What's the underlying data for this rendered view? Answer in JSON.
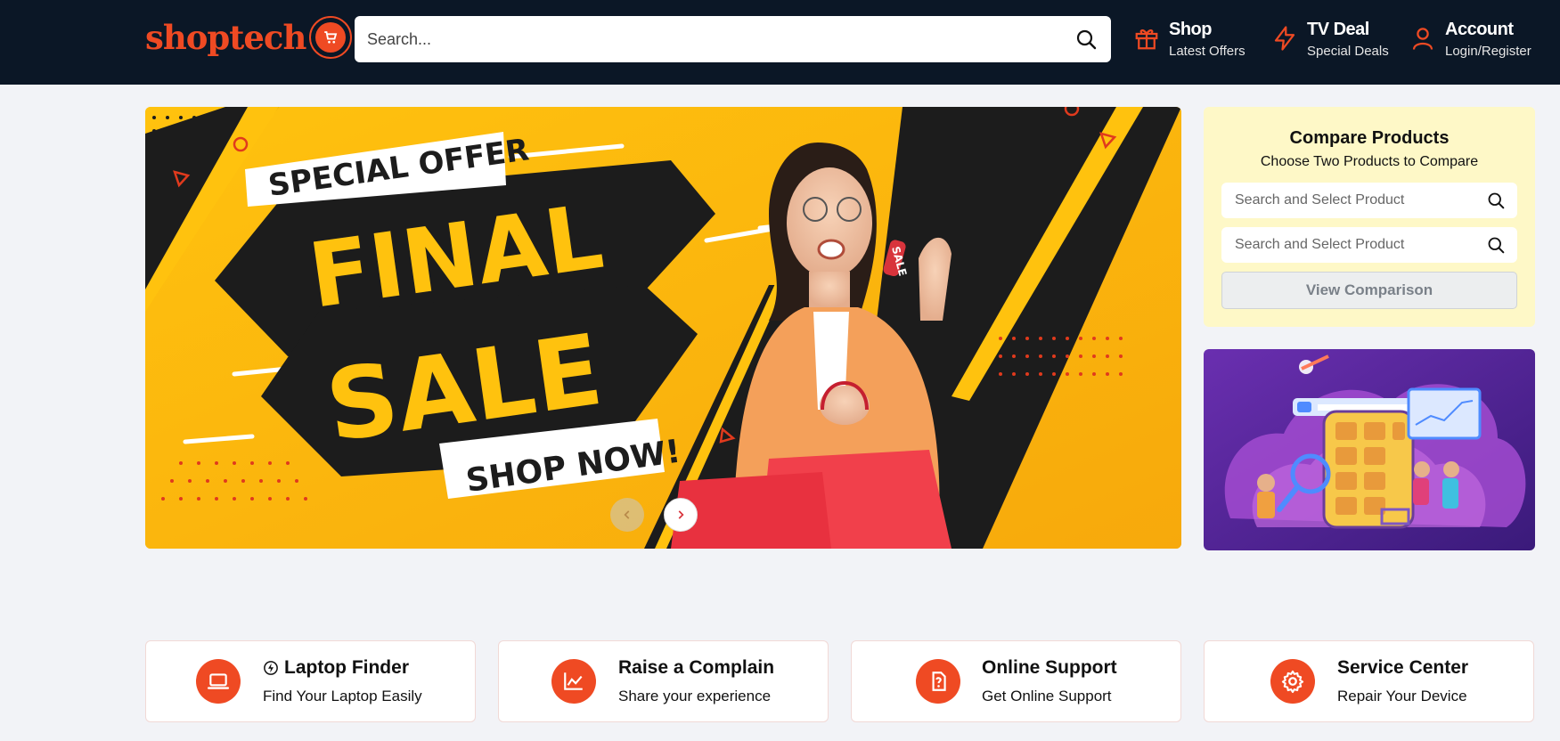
{
  "brand": {
    "name": "shoptech",
    "accent": "#ef4a23",
    "header_bg": "#0b1726"
  },
  "search": {
    "placeholder": "Search..."
  },
  "nav": [
    {
      "title": "Shop",
      "subtitle": "Latest Offers",
      "icon": "gift-icon"
    },
    {
      "title": "TV Deal",
      "subtitle": "Special Deals",
      "icon": "lightning-icon"
    },
    {
      "title": "Account",
      "subtitle": "Login/Register",
      "icon": "user-icon"
    }
  ],
  "banner": {
    "tag": "SPECIAL OFFER",
    "line1": "FINAL",
    "line2": "SALE",
    "cta": "SHOP NOW!",
    "price_tag": "SALE"
  },
  "compare": {
    "title": "Compare Products",
    "subtitle": "Choose Two Products to Compare",
    "input1_placeholder": "Search and Select Product",
    "input2_placeholder": "Search and Select Product",
    "button": "View Comparison"
  },
  "cards": [
    {
      "title": "Laptop Finder",
      "subtitle": "Find Your Laptop Easily",
      "icon": "laptop-icon"
    },
    {
      "title": "Raise a Complain",
      "subtitle": "Share your experience",
      "icon": "chart-icon"
    },
    {
      "title": "Online Support",
      "subtitle": "Get Online Support",
      "icon": "question-icon"
    },
    {
      "title": "Service Center",
      "subtitle": "Repair Your Device",
      "icon": "gear-icon"
    }
  ]
}
